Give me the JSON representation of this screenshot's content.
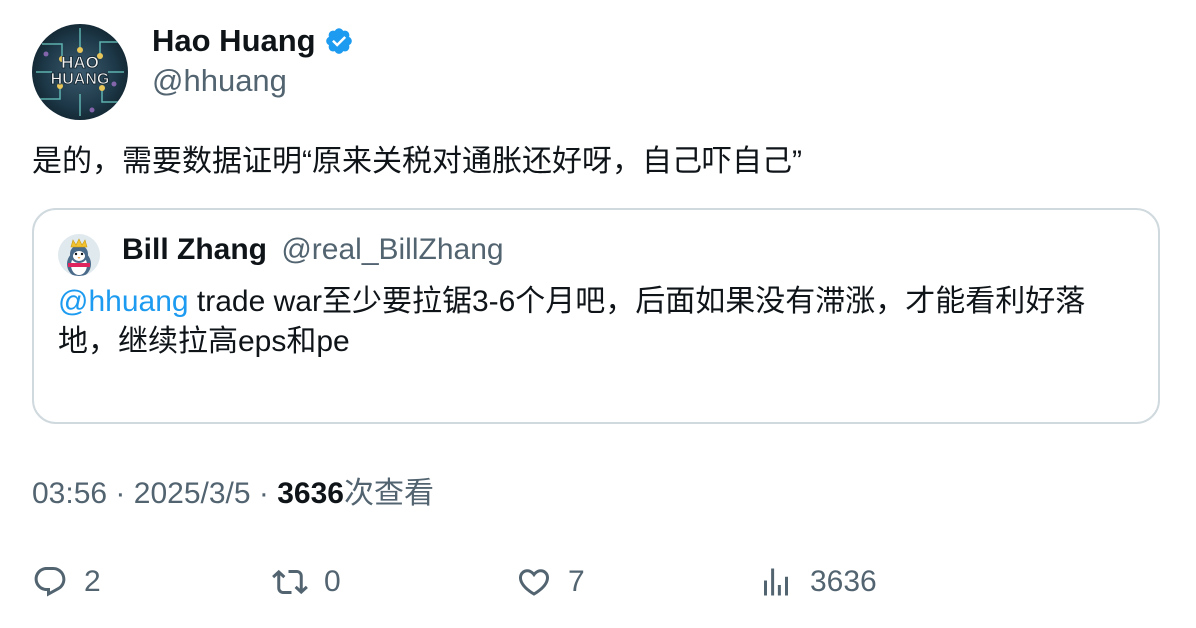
{
  "author": {
    "name": "Hao Huang",
    "handle": "@hhuang",
    "avatar_text_top": "HAO",
    "avatar_text_bottom": "HUANG",
    "verified_icon": "verified-badge-icon",
    "verified_color": "#1d9bf0"
  },
  "tweet": {
    "text": "是的，需要数据证明“原来关税对通胀还好呀，自己吓自己”"
  },
  "quote": {
    "name": "Bill Zhang",
    "handle": "@real_BillZhang",
    "mention": "@hhuang",
    "text": " trade war至少要拉锯3-6个月吧，后面如果没有滞涨，才能看利好落地，继续拉高eps和pe"
  },
  "meta": {
    "time": "03:56",
    "separator": "·",
    "date": "2025/3/5",
    "views_count": "3636",
    "views_label": "次查看"
  },
  "actions": {
    "replies": "2",
    "retweets": "0",
    "likes": "7",
    "views": "3636"
  },
  "colors": {
    "text": "#0f1419",
    "secondary": "#536471",
    "accent": "#1d9bf0",
    "border": "#cfd9de"
  }
}
